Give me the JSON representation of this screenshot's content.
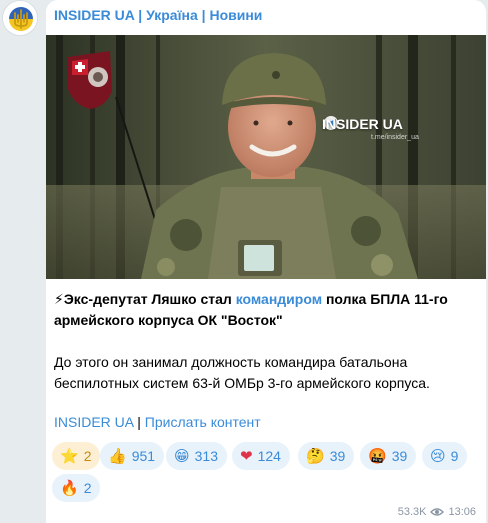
{
  "channel": {
    "name": "INSIDER UA | Україна | Новини"
  },
  "media": {
    "watermark": "INSIDER UA",
    "watermark_handle": "t.me/insider_ua",
    "icons": [
      "shield-logo",
      "telegram-icon"
    ]
  },
  "post": {
    "headline_emoji": "⚡",
    "headline_part1": "Экс-депутат Ляшко стал ",
    "headline_link": "командиром",
    "headline_part2": " полка БПЛА 11-го армейского корпуса ОК \"Восток\"",
    "paragraph": "До этого он занимал должность командира батальона беспилотных систем 63-й ОМБр 3-го армейского корпуса.",
    "link1": "INSIDER UA",
    "separator": " | ",
    "link2": "Прислать контент"
  },
  "reactions": [
    {
      "emoji": "⭐",
      "count": "2"
    },
    {
      "emoji": "👍",
      "count": "951"
    },
    {
      "emoji": "😁",
      "count": "313"
    },
    {
      "emoji": "❤",
      "count": "124"
    },
    {
      "emoji": "🤔",
      "count": "39"
    },
    {
      "emoji": "🤬",
      "count": "39"
    },
    {
      "emoji": "😢",
      "count": "9"
    },
    {
      "emoji": "🔥",
      "count": "2"
    }
  ],
  "meta": {
    "views": "53.3K",
    "time": "13:06"
  },
  "colors": {
    "accent": "#3a8bd8",
    "bubble": "#ffffff",
    "background": "#e6ebee"
  }
}
